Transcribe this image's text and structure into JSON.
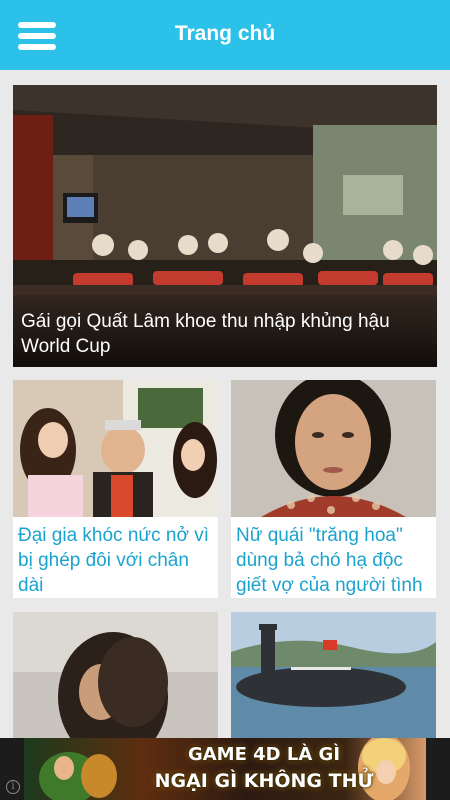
{
  "header": {
    "title": "Trang chủ",
    "menu_icon": "hamburger-menu-icon"
  },
  "featured": {
    "title": "Gái gọi Quất Lâm khoe thu nhập khủng hậu World Cup"
  },
  "articles": [
    {
      "title": "Đại gia khóc nức nở vì bị ghép đôi với chân dài"
    },
    {
      "title": "Nữ quái \"trăng hoa\" dùng bả chó hạ độc giết vợ của người tình"
    },
    {
      "title": ""
    },
    {
      "title": ""
    }
  ],
  "ad": {
    "line1": "GAME 4D LÀ GÌ",
    "line2": "NGẠI GÌ KHÔNG THỬ",
    "info_icon": "info-icon"
  },
  "colors": {
    "header_bg": "#2cc1e8",
    "link": "#1ba3cf"
  }
}
